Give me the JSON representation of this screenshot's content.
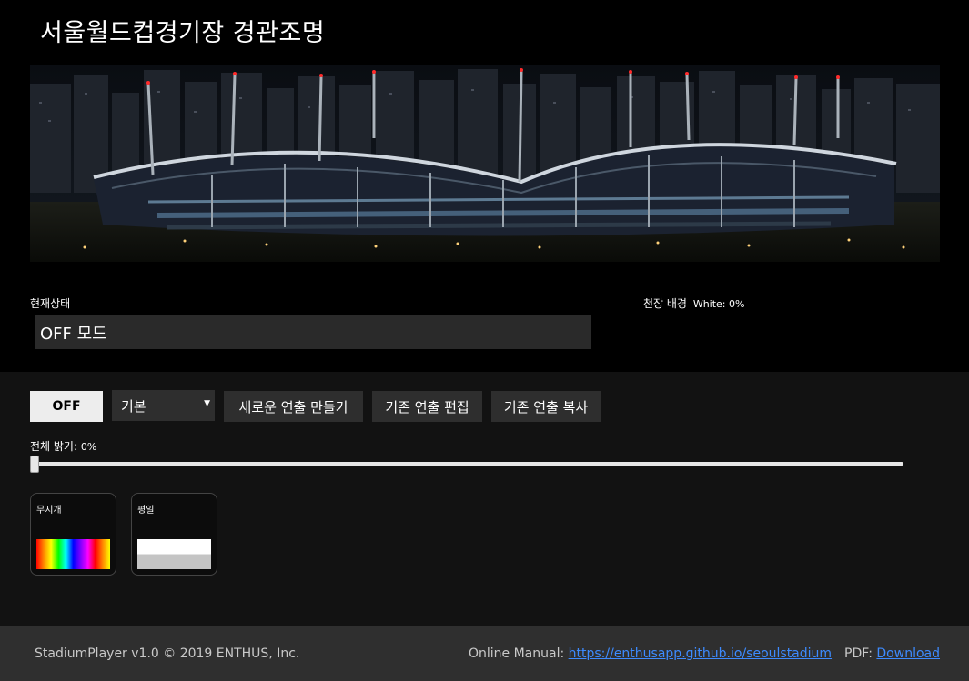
{
  "header": {
    "title": "서울월드컵경기장 경관조명"
  },
  "status": {
    "label": "현재상태",
    "value": "OFF 모드"
  },
  "ceiling": {
    "label": "천장 배경",
    "value": "White: 0%"
  },
  "controls": {
    "off_label": "OFF",
    "mode_select": {
      "selected": "기본"
    },
    "new_show_label": "새로운 연출 만들기",
    "edit_show_label": "기존 연출 편집",
    "copy_show_label": "기존 연출 복사"
  },
  "brightness": {
    "label": "전체 밝기: ",
    "value": "0%",
    "level": 0
  },
  "presets": [
    {
      "label": "무지개",
      "swatch": "rainbow"
    },
    {
      "label": "평일",
      "swatch": "white-grey"
    }
  ],
  "footer": {
    "copyright": "StadiumPlayer v1.0 © 2019 ENTHUS, Inc.",
    "manual_label": "Online Manual: ",
    "manual_link": "https://enthusapp.github.io/seoulstadium",
    "pdf_label": "PDF: ",
    "pdf_link": "Download"
  },
  "colors": {
    "accent_link": "#3d8bff",
    "background_top": "#000000",
    "background_controls": "#121212",
    "footer_bg": "#2f2f2f"
  }
}
